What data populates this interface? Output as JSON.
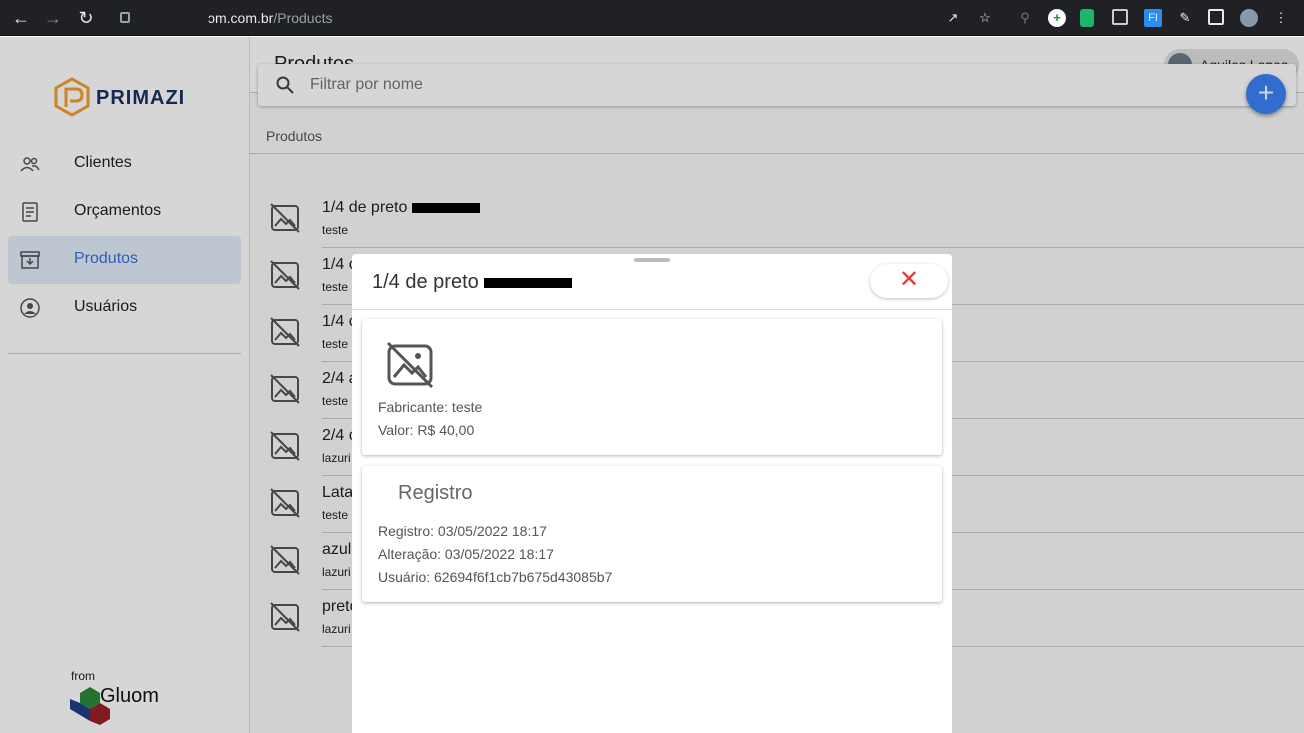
{
  "browser": {
    "url_host": "ɔm.com.br",
    "url_path": "/Products"
  },
  "sidebar": {
    "logo_text": "PRIMAZI",
    "items": [
      {
        "label": "Clientes",
        "icon": "people-icon"
      },
      {
        "label": "Orçamentos",
        "icon": "document-icon"
      },
      {
        "label": "Produtos",
        "icon": "archive-icon",
        "active": true
      },
      {
        "label": "Usuários",
        "icon": "account-circle-icon"
      }
    ],
    "footer_from": "from",
    "footer_brand": "Gluom"
  },
  "header": {
    "title": "Produtos",
    "user_name": "Aquiles Lopes"
  },
  "search": {
    "placeholder": "Filtrar por nome"
  },
  "fab_label": "+",
  "list": {
    "section_label": "Produtos",
    "rows": [
      {
        "name": "1/4 de preto",
        "sub": "teste"
      },
      {
        "name": "1/4 c",
        "sub": "teste"
      },
      {
        "name": "1/4 c",
        "sub": "teste"
      },
      {
        "name": "2/4 a",
        "sub": "teste"
      },
      {
        "name": "2/4 c",
        "sub": "lazuri"
      },
      {
        "name": "Lata",
        "sub": "teste"
      },
      {
        "name": "azul",
        "sub": "lazuri"
      },
      {
        "name": "preto",
        "sub": "lazuri"
      }
    ]
  },
  "modal": {
    "title": "1/4 de preto",
    "close_label": "✕",
    "fabricante": "Fabricante: teste",
    "valor": "Valor: R$ 40,00",
    "registro_heading": "Registro",
    "registro": "Registro: 03/05/2022 18:17",
    "alteracao": "Alteração: 03/05/2022 18:17",
    "usuario": "Usuário: 62694f6f1cb7b675d43085b7"
  },
  "colors": {
    "accent": "#3b6fd4",
    "fab": "#3b82f6",
    "close": "#e53935"
  }
}
